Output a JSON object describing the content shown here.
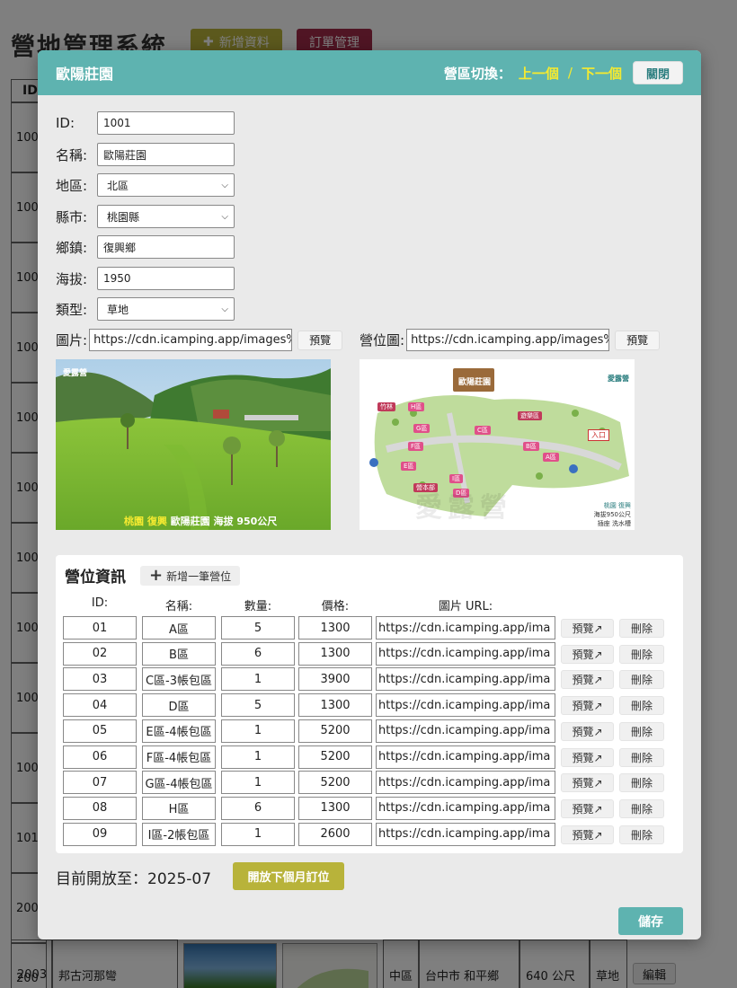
{
  "page": {
    "title": "營地管理系統",
    "add_button": "新增資料",
    "order_button": "訂單管理",
    "table_header_id": "ID",
    "row_ids": [
      "100",
      "100",
      "100",
      "100",
      "100",
      "100",
      "100",
      "100",
      "100",
      "100",
      "101",
      "200",
      "200"
    ],
    "last_row": {
      "id": "2003",
      "name": "邦古河那彎",
      "region": "中區",
      "city": "台中市 和平鄉",
      "altitude": "640 公尺",
      "type": "草地",
      "edit": "編輯"
    }
  },
  "modal": {
    "title": "歐陽莊園",
    "switch_label": "營區切換：",
    "prev": "上一個",
    "separator": "/",
    "next": "下一個",
    "close": "關閉",
    "fields": {
      "id_label": "ID:",
      "id_value": "1001",
      "name_label": "名稱:",
      "name_value": "歐陽莊園",
      "region_label": "地區:",
      "region_value": "北區",
      "city_label": "縣市:",
      "city_value": "桃園縣",
      "town_label": "鄉鎮:",
      "town_value": "復興鄉",
      "altitude_label": "海拔:",
      "altitude_value": "1950",
      "type_label": "類型:",
      "type_value": "草地"
    },
    "image_label": "圖片:",
    "image_url": "https://cdn.icamping.app/images%",
    "map_label": "營位圖:",
    "map_url": "https://cdn.icamping.app/images%",
    "preview": "預覽",
    "photo_caption": {
      "brand": "愛露營",
      "place_prefix_a": "桃園",
      "place_prefix_b": "復興",
      "text": "歐陽莊園 海拔 950公尺"
    },
    "map_text": {
      "sign": "歐陽莊園",
      "brand": "愛露營",
      "entrance": "入口",
      "zones": [
        "H區",
        "G區",
        "F區",
        "E區",
        "D區",
        "I區",
        "C區",
        "B區",
        "A區"
      ],
      "other": [
        "竹林",
        "遊樂區",
        "營本部"
      ],
      "info_a": "桃園 復興",
      "info_b": "海拔950公尺",
      "legend_a": "插座",
      "legend_b": "洗水槽",
      "watermark": "愛露營"
    },
    "camp_section": {
      "title": "營位資訊",
      "add": "新增一筆營位",
      "headers": {
        "id": "ID:",
        "name": "名稱:",
        "qty": "數量:",
        "price": "價格:",
        "url": "圖片 URL:"
      },
      "preview_label": "預覽↗",
      "delete_label": "刪除",
      "rows": [
        {
          "id": "01",
          "name": "A區",
          "qty": "5",
          "price": "1300",
          "url": "https://cdn.icamping.app/ima"
        },
        {
          "id": "02",
          "name": "B區",
          "qty": "6",
          "price": "1300",
          "url": "https://cdn.icamping.app/ima"
        },
        {
          "id": "03",
          "name": "C區-3帳包區",
          "qty": "1",
          "price": "3900",
          "url": "https://cdn.icamping.app/ima"
        },
        {
          "id": "04",
          "name": "D區",
          "qty": "5",
          "price": "1300",
          "url": "https://cdn.icamping.app/ima"
        },
        {
          "id": "05",
          "name": "E區-4帳包區",
          "qty": "1",
          "price": "5200",
          "url": "https://cdn.icamping.app/ima"
        },
        {
          "id": "06",
          "name": "F區-4帳包區",
          "qty": "1",
          "price": "5200",
          "url": "https://cdn.icamping.app/ima"
        },
        {
          "id": "07",
          "name": "G區-4帳包區",
          "qty": "1",
          "price": "5200",
          "url": "https://cdn.icamping.app/ima"
        },
        {
          "id": "08",
          "name": "H區",
          "qty": "6",
          "price": "1300",
          "url": "https://cdn.icamping.app/ima"
        },
        {
          "id": "09",
          "name": "I區-2帳包區",
          "qty": "1",
          "price": "2600",
          "url": "https://cdn.icamping.app/ima"
        }
      ]
    },
    "open_until_label": "目前開放至：2025-07",
    "open_next_button": "開放下個月訂位",
    "save": "儲存"
  },
  "colors": {
    "header_teal": "#5eb3b0",
    "link_yellow": "#f5ea30",
    "olive_button": "#b8b33a",
    "order_button": "#a02a48"
  }
}
